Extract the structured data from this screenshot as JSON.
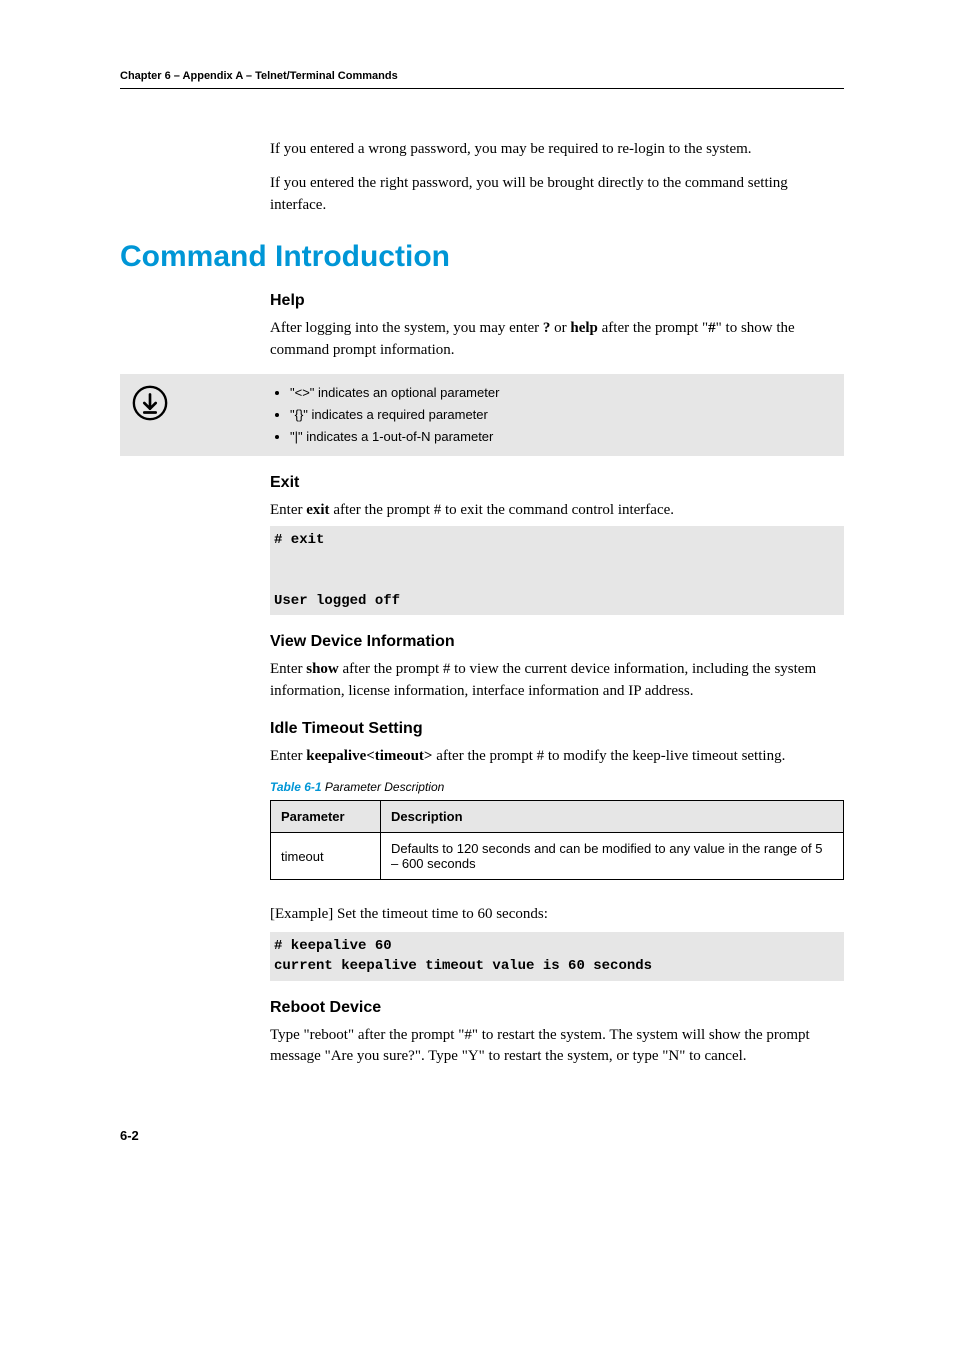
{
  "header": "Chapter 6 – Appendix A – Telnet/Terminal Commands",
  "intro": {
    "p1": "If you entered a wrong password, you may be required to re-login to the system.",
    "p2": "If you entered the right password, you will be brought directly to the command setting interface."
  },
  "sectionTitle": "Command Introduction",
  "help": {
    "title": "Help",
    "p1_pre": "After logging into the system, you may enter ",
    "p1_b1": "?",
    "p1_mid": " or ",
    "p1_b2": "help",
    "p1_post": " after the prompt \"",
    "p1_b3": "#",
    "p1_end": "\" to show the command prompt information."
  },
  "note": {
    "b1": "\"<>\" indicates an optional parameter",
    "b2": "\"{}\" indicates a required parameter",
    "b3": "\"|\"    indicates a 1-out-of-N parameter"
  },
  "exit": {
    "title": "Exit",
    "p1_pre": "Enter ",
    "p1_b": "exit",
    "p1_post": " after the prompt # to exit the command control interface.",
    "code": "# exit\n\n\nUser logged off"
  },
  "view": {
    "title": "View Device Information",
    "p1_pre": "Enter ",
    "p1_b": "show",
    "p1_post": " after the prompt # to view the current device information, including the system information, license information, interface information and IP address."
  },
  "idle": {
    "title": "Idle Timeout Setting",
    "p1_pre": "Enter ",
    "p1_b": "keepalive<timeout>",
    "p1_post": " after the prompt # to modify the keep-live timeout setting.",
    "tableCaptionLabel": "Table 6-1",
    "tableCaptionRest": " Parameter Description",
    "th1": "Parameter",
    "th2": "Description",
    "td1": "timeout",
    "td2": "Defaults to 120 seconds and can be modified to any value in the range of 5 – 600 seconds",
    "example": "[Example] Set the timeout time to 60 seconds:",
    "code": "# keepalive 60\ncurrent keepalive timeout value is 60 seconds"
  },
  "reboot": {
    "title": "Reboot Device",
    "p1": "Type \"reboot\" after the prompt \"#\" to restart the system. The system will show the prompt message \"Are you sure?\". Type \"Y\" to restart the system, or type \"N\" to cancel."
  },
  "pageNumber": "6-2"
}
